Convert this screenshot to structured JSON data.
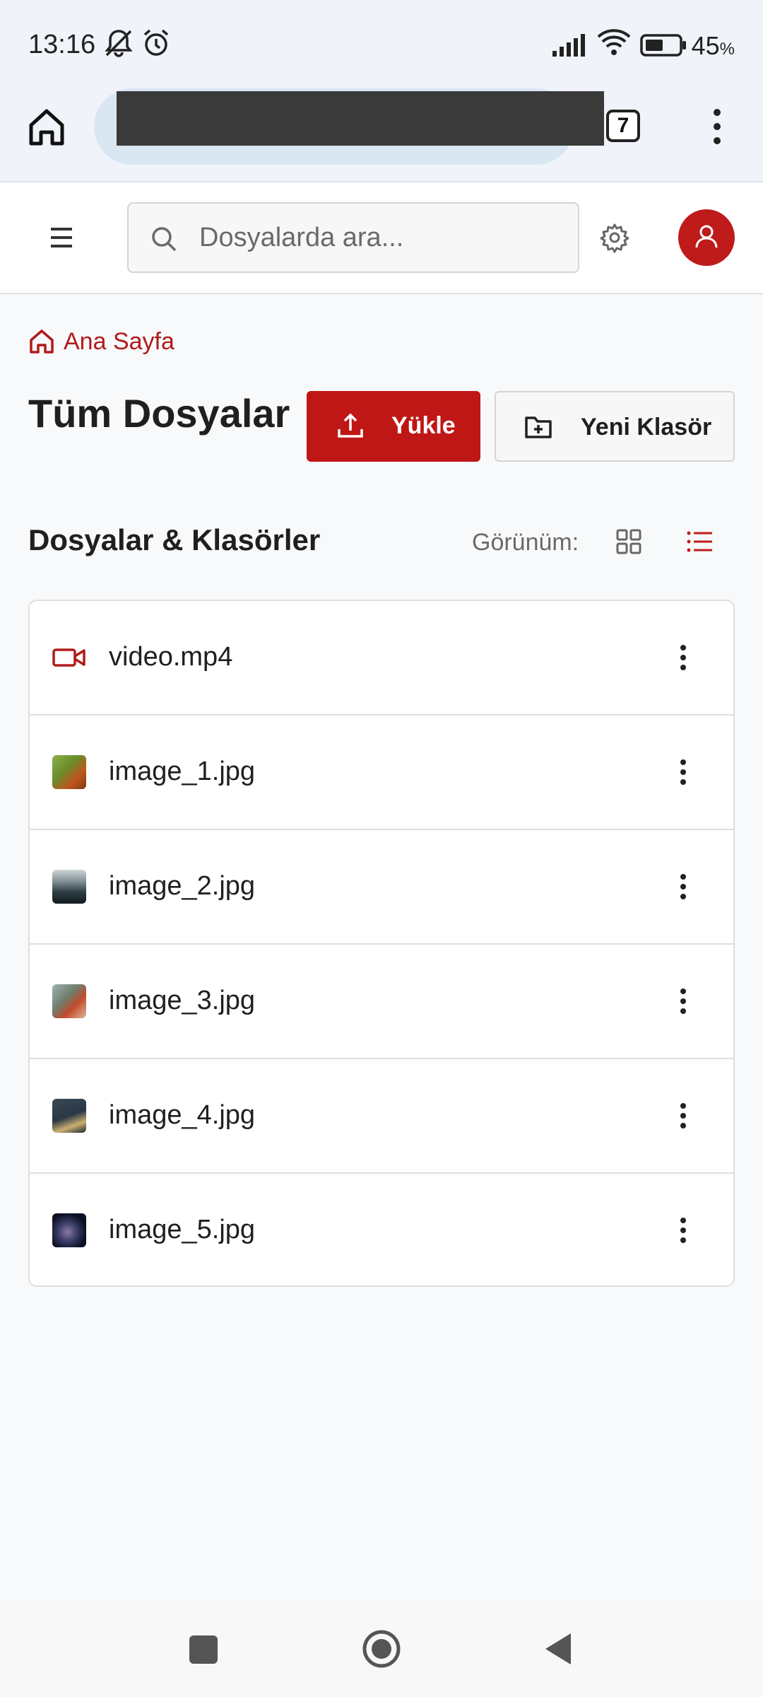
{
  "status_bar": {
    "time": "13:16",
    "battery_percent": "45",
    "battery_suffix": "%"
  },
  "browser": {
    "url_text": "",
    "tab_count": "7"
  },
  "header": {
    "search_placeholder": "Dosyalarda ara..."
  },
  "breadcrumb": {
    "label": "Ana Sayfa"
  },
  "main": {
    "title": "Tüm Dosyalar",
    "upload_label": "Yükle",
    "new_folder_label": "Yeni Klasör",
    "section_title": "Dosyalar & Klasörler",
    "view_label": "Görünüm:",
    "active_view": "list"
  },
  "files": [
    {
      "name": "video.mp4",
      "icon": "video-icon"
    },
    {
      "name": "image_1.jpg",
      "icon": "image-thumbnail"
    },
    {
      "name": "image_2.jpg",
      "icon": "image-thumbnail"
    },
    {
      "name": "image_3.jpg",
      "icon": "image-thumbnail"
    },
    {
      "name": "image_4.jpg",
      "icon": "image-thumbnail"
    },
    {
      "name": "image_5.jpg",
      "icon": "image-thumbnail"
    }
  ],
  "colors": {
    "accent": "#bf1616",
    "background": "#f8f9fa",
    "browser_bar": "#f0f4fa"
  }
}
